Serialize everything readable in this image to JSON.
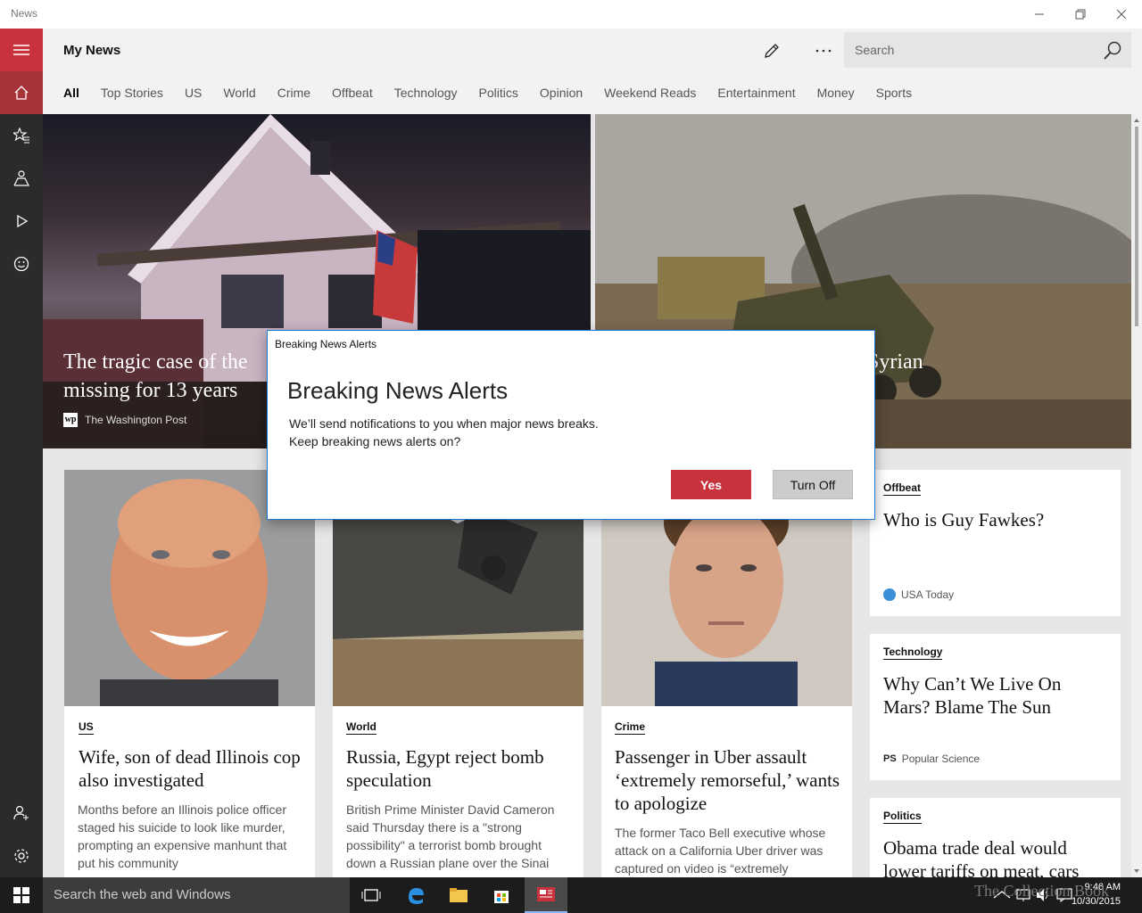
{
  "window": {
    "app_title": "News"
  },
  "header": {
    "title": "My News",
    "search_placeholder": "Search"
  },
  "tabs": [
    {
      "label": "All",
      "active": true
    },
    {
      "label": "Top Stories"
    },
    {
      "label": "US"
    },
    {
      "label": "World"
    },
    {
      "label": "Crime"
    },
    {
      "label": "Offbeat"
    },
    {
      "label": "Technology"
    },
    {
      "label": "Politics"
    },
    {
      "label": "Opinion"
    },
    {
      "label": "Weekend Reads"
    },
    {
      "label": "Entertainment"
    },
    {
      "label": "Money"
    },
    {
      "label": "Sports"
    }
  ],
  "sidebar": {
    "icons": [
      "hamburger-menu-icon",
      "home-icon",
      "interests-star-icon",
      "local-icon",
      "video-play-icon",
      "smiley-icon",
      "account-add-icon",
      "settings-gear-icon"
    ]
  },
  "hero": [
    {
      "headline_line1": "The tragic case of the",
      "headline_line2": "missing for 13 years",
      "source": "The Washington Post"
    },
    {
      "headline_partial": "Syrian"
    }
  ],
  "cards": [
    {
      "category": "US",
      "headline": "Wife, son of dead Illinois cop also investigated",
      "summary": "Months before an Illinois police officer staged his suicide to look like murder, prompting an expensive manhunt that put his community"
    },
    {
      "category": "World",
      "headline": "Russia, Egypt reject bomb speculation",
      "summary": "British Prime Minister David Cameron said Thursday there is a \"strong possibility\" a terrorist bomb brought down a Russian plane over the Sinai"
    },
    {
      "category": "Crime",
      "headline": "Passenger in Uber assault ‘extremely remorseful,’ wants to apologize",
      "summary": "The former Taco Bell executive whose attack on a California Uber driver was captured on video is “extremely"
    },
    {
      "category": "Offbeat",
      "headline": "Who is Guy Fawkes?",
      "source": "USA Today"
    },
    {
      "category": "Technology",
      "headline": "Why Can’t We Live On Mars? Blame The Sun",
      "source": "Popular Science"
    },
    {
      "category": "Politics",
      "headline": "Obama trade deal would lower tariffs on meat, cars"
    }
  ],
  "dialog": {
    "window_title": "Breaking News Alerts",
    "heading": "Breaking News Alerts",
    "message_line1": "We’ll send notifications to you when major news breaks.",
    "message_line2": "Keep breaking news alerts on?",
    "yes_label": "Yes",
    "off_label": "Turn Off"
  },
  "taskbar": {
    "search_placeholder": "Search the web and Windows",
    "time": "9:46 AM",
    "date": "10/30/2015",
    "watermark": "The Collection Book"
  },
  "colors": {
    "accent": "#c8323c",
    "sidebar": "#2b2b2b",
    "taskbar": "#1c1c1c"
  }
}
